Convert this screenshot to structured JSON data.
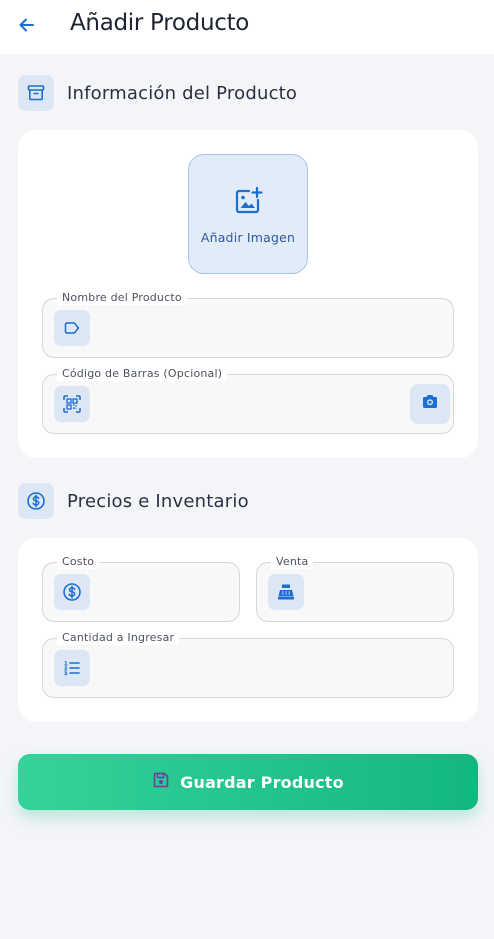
{
  "header": {
    "title": "Añadir Producto",
    "back_icon": "arrow-left-icon"
  },
  "product_info": {
    "title": "Información del Producto",
    "icon": "archive-box-icon",
    "image_picker": {
      "label": "Añadir Imagen",
      "icon": "image-add-icon"
    },
    "name_field": {
      "label": "Nombre del Producto",
      "value": "",
      "icon": "tag-icon"
    },
    "barcode_field": {
      "label": "Código de Barras (Opcional)",
      "value": "",
      "icon": "qr-scan-icon",
      "action_icon": "camera-icon"
    }
  },
  "pricing": {
    "title": "Precios e Inventario",
    "icon": "dollar-circle-icon",
    "cost_field": {
      "label": "Costo",
      "value": "",
      "icon": "dollar-circle-icon"
    },
    "sale_field": {
      "label": "Venta",
      "value": "",
      "icon": "cash-register-icon"
    },
    "quantity_field": {
      "label": "Cantidad a Ingresar",
      "value": "",
      "icon": "numbered-list-icon"
    }
  },
  "save_button": {
    "label": "Guardar Producto",
    "icon": "save-disk-icon"
  },
  "colors": {
    "primary_blue": "#1a6fd0",
    "accent_green_start": "#34d39a",
    "accent_green_end": "#12b77f",
    "background": "#f4f5f9",
    "icon_tile": "#dde6f4"
  }
}
